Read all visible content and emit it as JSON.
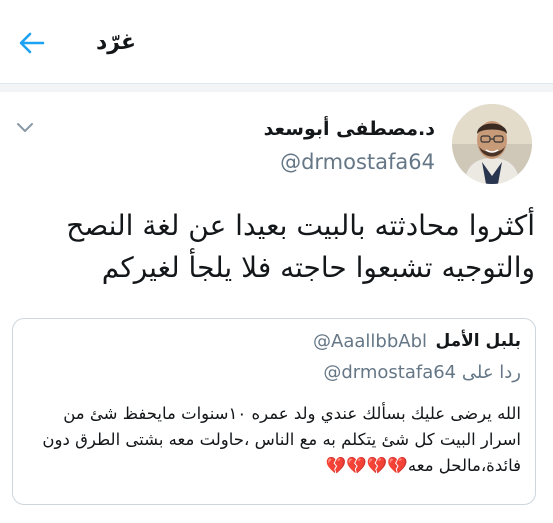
{
  "header": {
    "title": "غرّد",
    "back_icon": "arrow-left-icon",
    "accent_color": "#1da1f2"
  },
  "tweet": {
    "author_name": "د.مصطفى أبوسعد",
    "author_handle": "@drmostafa64",
    "text": "أكثروا محادثته بالبيت بعيدا عن لغة النصح والتوجيه تشبعوا حاجته فلا يلجأ لغيركم",
    "menu_icon": "chevron-down-icon",
    "avatar_icon": "avatar-photo"
  },
  "quoted_tweet": {
    "author_name": "بلبل الأمل",
    "author_handle": "@AaallbbAbl",
    "replying_prefix": "ردا على",
    "replying_handle": "@drmostafa64",
    "text": "الله يرضى عليك بسألك عندي ولد عمره ١٠سنوات مايحفظ شئ من اسرار البيت كل شئ يتكلم به مع الناس ،حاولت معه بشتى الطرق دون فائدة،مالحل معه",
    "emoji": "💔💔💔💔",
    "emoji_color": "#d5459e"
  }
}
